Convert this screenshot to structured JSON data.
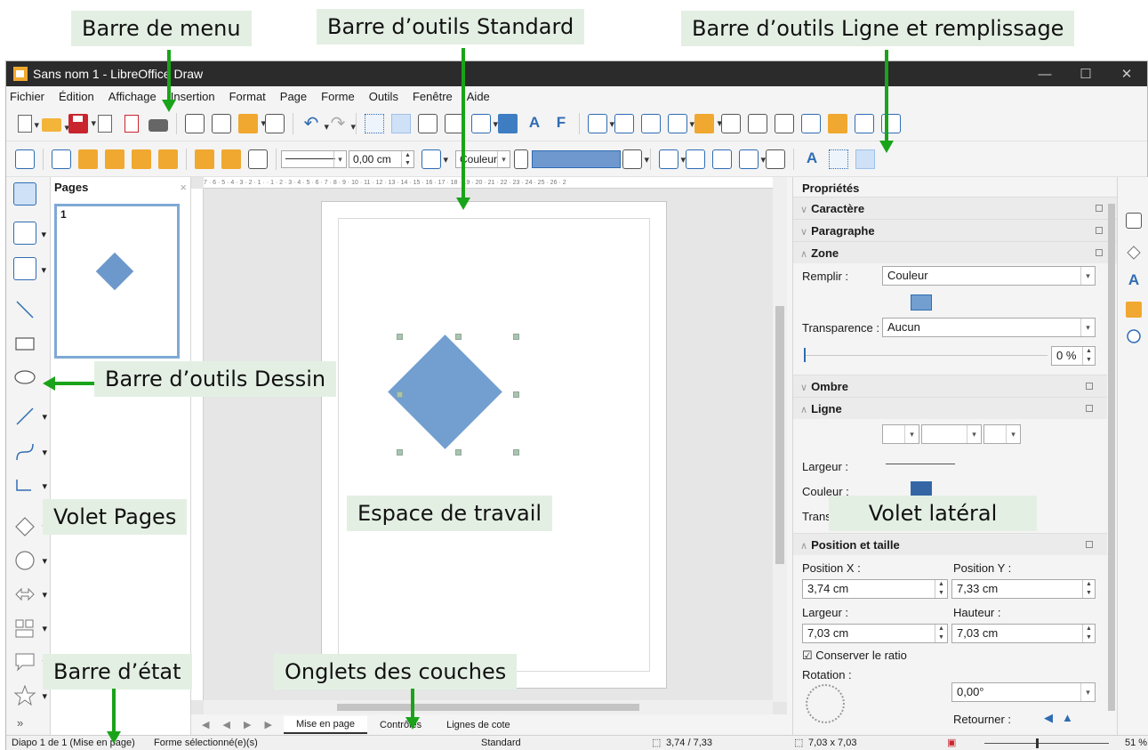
{
  "callouts": {
    "menu_bar": "Barre de menu",
    "standard_toolbar": "Barre d’outils Standard",
    "line_fill_toolbar": "Barre d’outils Ligne et remplissage",
    "drawing_toolbar": "Barre d’outils Dessin",
    "pages_pane": "Volet Pages",
    "workspace": "Espace de travail",
    "sidebar": "Volet latéral",
    "status_bar": "Barre d’état",
    "layer_tabs": "Onglets des couches"
  },
  "window": {
    "title": "Sans nom 1 - LibreOffice Draw",
    "minimize": "—",
    "maximize": "☐",
    "close": "✕"
  },
  "menu": [
    "Fichier",
    "Édition",
    "Affichage",
    "Insertion",
    "Format",
    "Page",
    "Forme",
    "Outils",
    "Fenêtre",
    "Aide"
  ],
  "line_fill": {
    "line_width": "0,00 cm",
    "area_style": "Couleur"
  },
  "pages_pane": {
    "title": "Pages",
    "close": "×",
    "page_number": "1"
  },
  "ruler": {
    "horizontal": "7 · 6 · 5 · 4 · 3 · 2 · 1 · · 1 · 2 · 3 · 4 · 5 · 6 · 7 · 8 · 9 · 10 · 11 · 12 · 13 · 14 · 15 · 16 · 17 · 18 · 19 · 20 · 21 · 22 · 23 · 24 · 25 · 26 · 2"
  },
  "layer_tabs": [
    "Mise en page",
    "Contrôles",
    "Lignes de cote"
  ],
  "layer_nav": "◀ ◀ ▶ ▶",
  "sidebar": {
    "title": "Propriétés",
    "sections": {
      "character": "Caractère",
      "paragraph": "Paragraphe",
      "area": "Zone",
      "shadow": "Ombre",
      "line": "Ligne",
      "position_size": "Position et taille"
    },
    "fill_label": "Remplir :",
    "fill_value": "Couleur",
    "transparency_label": "Transparence :",
    "transparency_value": "Aucun",
    "transparency_pct": "0 %",
    "line_width_label": "Largeur :",
    "line_color_label": "Couleur :",
    "line_trans_label": "Trans",
    "pos_x_label": "Position X :",
    "pos_x": "3,74 cm",
    "pos_y_label": "Position Y :",
    "pos_y": "7,33 cm",
    "width_label": "Largeur :",
    "width": "7,03 cm",
    "height_label": "Hauteur :",
    "height": "7,03 cm",
    "keep_ratio": "Conserver le ratio",
    "rotation_label": "Rotation :",
    "rotation": "0,00°",
    "flip_label": "Retourner :"
  },
  "statusbar": {
    "slide": "Diapo 1 de 1 (Mise en page)",
    "selection": "Forme sélectionné(e)(s)",
    "master": "Standard",
    "position": "3,74 / 7,33",
    "size": "7,03 x 7,03",
    "zoom": "51 %"
  },
  "colors": {
    "shape_fill": "#729fcf",
    "callout_bg": "#e4efe4",
    "arrow": "#1aa31a",
    "titlebar": "#2b2b2b"
  }
}
